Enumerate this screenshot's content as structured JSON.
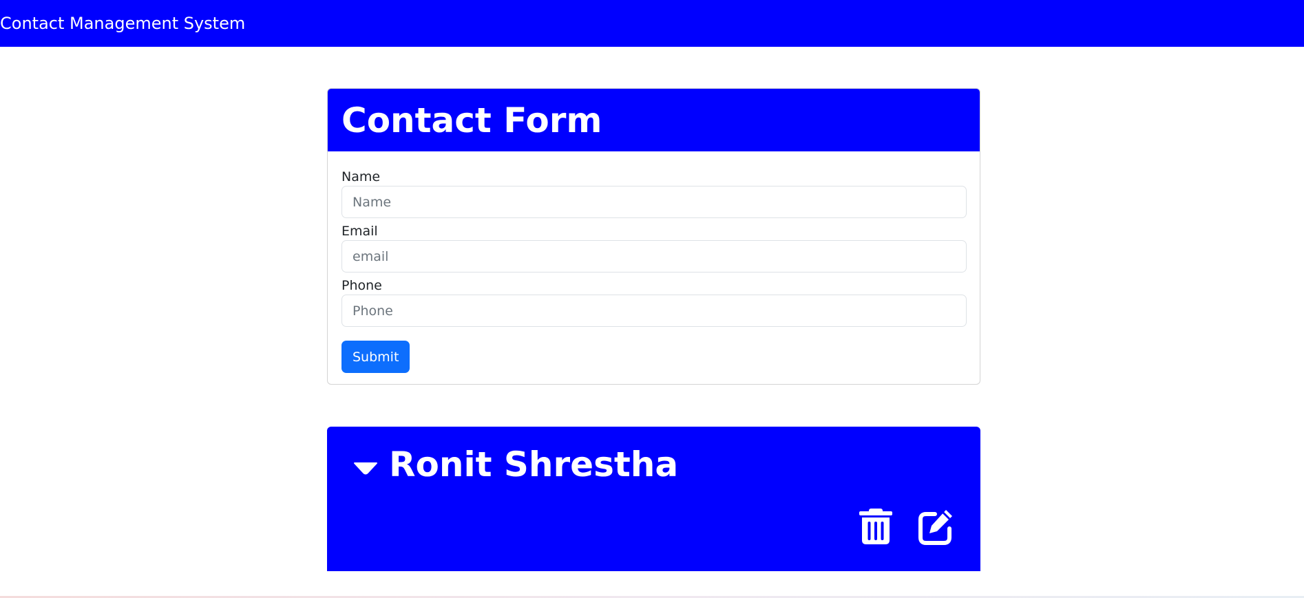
{
  "navbar": {
    "brand": "Contact Management System"
  },
  "form": {
    "title": "Contact Form",
    "fields": [
      {
        "label": "Name",
        "placeholder": "Name",
        "value": ""
      },
      {
        "label": "Email",
        "placeholder": "email",
        "value": ""
      },
      {
        "label": "Phone",
        "placeholder": "Phone",
        "value": ""
      }
    ],
    "submit_label": "Submit"
  },
  "contacts": [
    {
      "name": "Ronit Shrestha",
      "expand_icon": "caret-down-icon",
      "actions": [
        {
          "icon": "trash-icon"
        },
        {
          "icon": "edit-icon"
        }
      ]
    }
  ],
  "colors": {
    "primary_blue": "#0000ff",
    "button_blue": "#0d6efd",
    "white": "#ffffff"
  }
}
